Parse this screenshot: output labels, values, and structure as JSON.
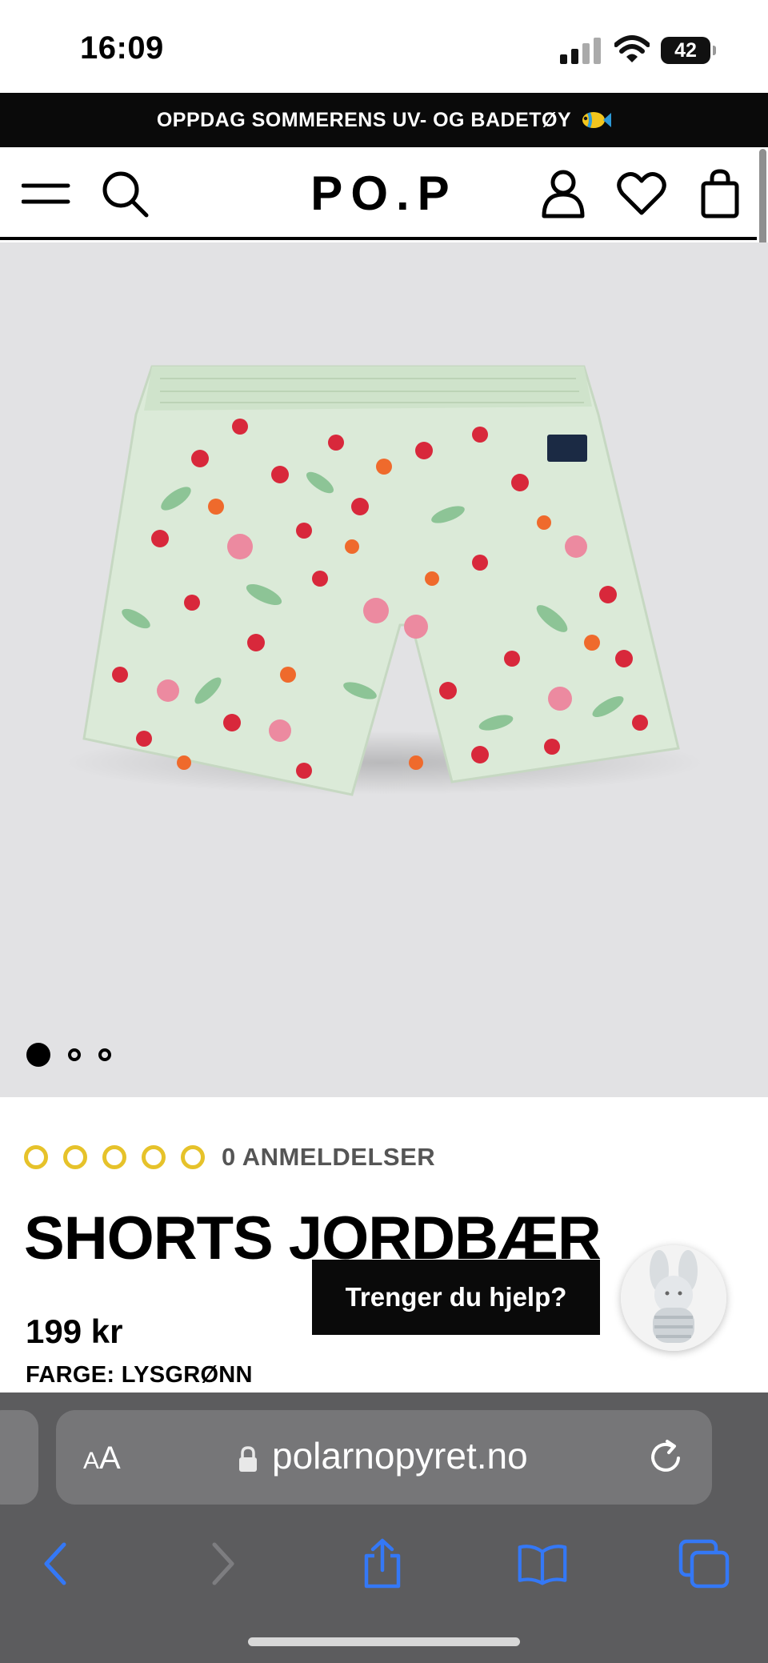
{
  "status_bar": {
    "time": "16:09",
    "battery": "42",
    "signal_icon": "cellular-signal-icon",
    "wifi_icon": "wifi-icon"
  },
  "promo": {
    "text": "OPPDAG SOMMERENS UV- OG BADETØY",
    "icon": "tropical-fish-icon"
  },
  "header": {
    "logo": "PO.P",
    "icons": [
      "menu-icon",
      "search-icon",
      "account-icon",
      "heart-icon",
      "shopping-bag-icon"
    ]
  },
  "gallery": {
    "image": "strawberry-print-shorts-photo",
    "slide_count": 3,
    "active_slide": 1
  },
  "product": {
    "rating": 0,
    "rating_max": 5,
    "reviews_label": "0 ANMELDELSER",
    "title": "SHORTS JORDBÆR",
    "price": "199 kr",
    "color_label": "FARGE: LYSGRØNN"
  },
  "help": {
    "label": "Trenger du hjelp?",
    "avatar": "plush-bunny-avatar"
  },
  "browser": {
    "text_size_label": "AA",
    "url": "polarnopyret.no",
    "nav_icons": [
      "back-icon",
      "forward-icon",
      "share-icon",
      "bookmarks-icon",
      "tabs-icon"
    ]
  },
  "colors": {
    "accent_star": "#e6c22a",
    "banner_bg": "#0a0a0a",
    "browser_tint": "#3478f6",
    "image_bg": "#e2e2e4"
  }
}
